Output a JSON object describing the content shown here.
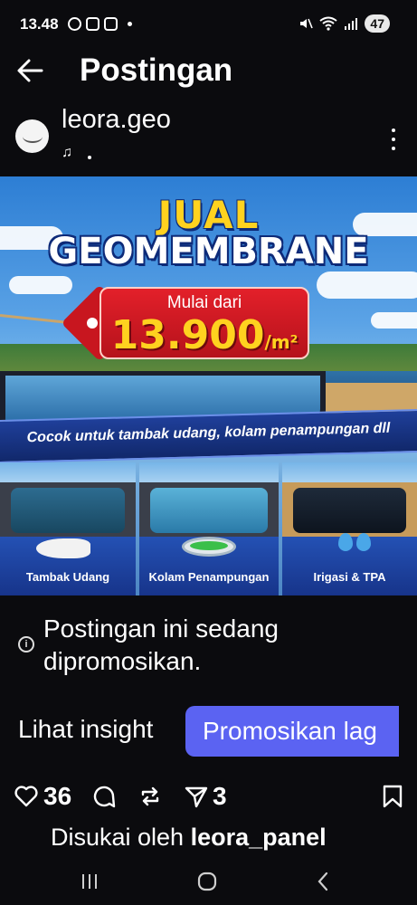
{
  "status_bar": {
    "time": "13.48",
    "battery": "47"
  },
  "header": {
    "title": "Postingan"
  },
  "author": {
    "username": "leora.geo",
    "music_glyph": "♫"
  },
  "post_image": {
    "headline_line1": "JUAL",
    "headline_line2": "GEOMEMBRANE",
    "price_prefix": "Mulai dari",
    "price": "13.900",
    "price_unit": "/m²",
    "banner": "Cocok untuk tambak udang, kolam penampungan dll",
    "panels": [
      {
        "label": "Tambak Udang"
      },
      {
        "label": "Kolam Penampungan"
      },
      {
        "label": "Irigasi & TPA"
      }
    ]
  },
  "promo": {
    "text": "Postingan ini sedang dipromosikan.",
    "insight_label": "Lihat insight",
    "promote_label": "Promosikan lag"
  },
  "actions": {
    "likes": "36",
    "shares": "3"
  },
  "likes_line": {
    "prefix": "Disukai oleh",
    "user": "leora_panel"
  },
  "colors": {
    "background": "#0b0b0e",
    "promote_button": "#5b63f2",
    "headline_yellow": "#ffd21f",
    "price_tag_red": "#d01a23"
  },
  "icons": [
    "back-arrow-icon",
    "more-options-icon",
    "info-icon",
    "heart-icon",
    "comment-icon",
    "repost-icon",
    "send-icon",
    "bookmark-icon",
    "recent-apps-icon",
    "home-icon",
    "back-nav-icon"
  ]
}
